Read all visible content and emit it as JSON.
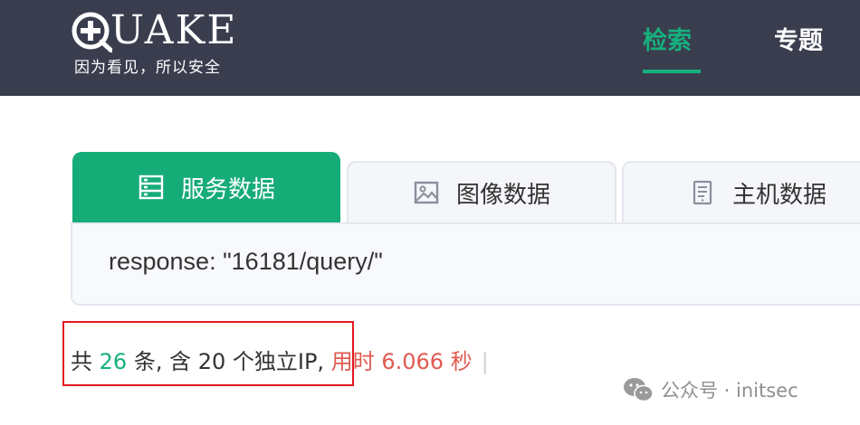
{
  "header": {
    "logo_text": "UAKE",
    "slogan": "因为看见，所以安全",
    "nav": [
      {
        "label": "检索",
        "active": true
      },
      {
        "label": "专题",
        "active": false
      }
    ]
  },
  "tabs": [
    {
      "label": "服务数据",
      "icon": "server-list-icon",
      "active": true
    },
    {
      "label": "图像数据",
      "icon": "image-icon",
      "active": false
    },
    {
      "label": "主机数据",
      "icon": "host-document-icon",
      "active": false
    }
  ],
  "query": {
    "value": "response: \"16181/query/\""
  },
  "result": {
    "prefix": "共 ",
    "count": "26",
    "mid": " 条, 含 20 个独立IP,",
    "time_text": " 用时 6.066 秒",
    "separator": "|"
  },
  "watermark": {
    "text": "公众号 · initsec"
  },
  "colors": {
    "header_bg": "#3a3d4e",
    "accent_green": "#16b07d",
    "time_red": "#e05a50",
    "highlight_red": "#e0191f"
  }
}
